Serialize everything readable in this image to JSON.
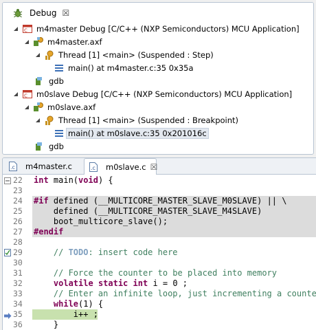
{
  "debug_view": {
    "tab_label": "Debug",
    "tree": [
      {
        "label": "m4master Debug [C/C++ (NXP Semiconductors) MCU Application]"
      },
      {
        "label": "m4master.axf"
      },
      {
        "label": "Thread [1] <main> (Suspended : Step)"
      },
      {
        "label": "main() at m4master.c:35 0x35a"
      },
      {
        "label": "gdb"
      },
      {
        "label": "m0slave Debug [C/C++ (NXP Semiconductors) MCU Application]"
      },
      {
        "label": "m0slave.axf"
      },
      {
        "label": "Thread [1] <main> (Suspended : Breakpoint)"
      },
      {
        "label": "main() at m0slave.c:35 0x201016c"
      },
      {
        "label": "gdb"
      }
    ]
  },
  "editor": {
    "tabs": [
      {
        "label": "m4master.c"
      },
      {
        "label": "m0slave.c"
      }
    ],
    "lines": [
      {
        "num": "22",
        "parts": [
          {
            "t": "int",
            "c": "kw"
          },
          {
            "t": " main(",
            "c": ""
          },
          {
            "t": "void",
            "c": "kw"
          },
          {
            "t": ") {",
            "c": ""
          }
        ]
      },
      {
        "num": "23",
        "parts": []
      },
      {
        "num": "24",
        "parts": [
          {
            "t": "#if",
            "c": "pp"
          },
          {
            "t": " defined (__MULTICORE_MASTER_SLAVE_M0SLAVE) || \\",
            "c": ""
          }
        ]
      },
      {
        "num": "25",
        "parts": [
          {
            "t": "    defined (__MULTICORE_MASTER_SLAVE_M4SLAVE)",
            "c": ""
          }
        ]
      },
      {
        "num": "26",
        "parts": [
          {
            "t": "    boot_multicore_slave();",
            "c": ""
          }
        ]
      },
      {
        "num": "27",
        "parts": [
          {
            "t": "#endif",
            "c": "pp"
          }
        ]
      },
      {
        "num": "28",
        "parts": []
      },
      {
        "num": "29",
        "parts": [
          {
            "t": "    // ",
            "c": "cm"
          },
          {
            "t": "TODO",
            "c": "todo"
          },
          {
            "t": ": insert code here",
            "c": "cm"
          }
        ]
      },
      {
        "num": "30",
        "parts": []
      },
      {
        "num": "31",
        "parts": [
          {
            "t": "    // Force the counter to be placed into memory",
            "c": "cm"
          }
        ]
      },
      {
        "num": "32",
        "parts": [
          {
            "t": "    ",
            "c": ""
          },
          {
            "t": "volatile",
            "c": "kw"
          },
          {
            "t": " ",
            "c": ""
          },
          {
            "t": "static",
            "c": "kw"
          },
          {
            "t": " ",
            "c": ""
          },
          {
            "t": "int",
            "c": "kw"
          },
          {
            "t": " i = 0 ;",
            "c": ""
          }
        ]
      },
      {
        "num": "33",
        "parts": [
          {
            "t": "    // Enter an infinite loop, just incrementing a counter",
            "c": "cm"
          }
        ]
      },
      {
        "num": "34",
        "parts": [
          {
            "t": "    ",
            "c": ""
          },
          {
            "t": "while",
            "c": "kw"
          },
          {
            "t": "(1) {",
            "c": ""
          }
        ]
      },
      {
        "num": "35",
        "parts": [
          {
            "t": "        i++ ;",
            "c": ""
          }
        ]
      },
      {
        "num": "36",
        "parts": [
          {
            "t": "    }",
            "c": ""
          }
        ]
      }
    ]
  }
}
